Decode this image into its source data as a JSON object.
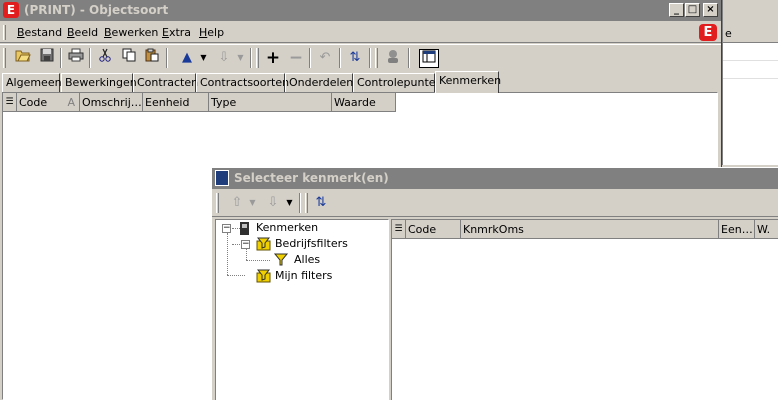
{
  "background_window": {
    "header_fragment": "e"
  },
  "main_window": {
    "title": "(PRINT) - Objectsoort",
    "app_icon_letter": "E",
    "caption_buttons": {
      "minimize": "_",
      "maximize": "□",
      "close": "×"
    }
  },
  "menu": {
    "items": [
      "Bestand",
      "Beeld",
      "Bewerken",
      "Extra",
      "Help"
    ],
    "brand_letter": "E"
  },
  "toolbar": {
    "icons": [
      "open-folder-icon",
      "save-icon",
      "print-icon",
      "cut-icon",
      "copy-icon",
      "paste-icon",
      "arrow-up-icon",
      "arrow-down-icon",
      "add-icon",
      "remove-icon",
      "undo-icon",
      "refresh-icon",
      "person-icon",
      "window-icon"
    ]
  },
  "tabs": {
    "items": [
      "Algemeen",
      "Bewerkingen",
      "Contracten",
      "Contractsoorten",
      "Onderdelen",
      "Controlepunten",
      "Kenmerken"
    ],
    "active": "Kenmerken"
  },
  "grid": {
    "columns": [
      "Code",
      "Omschrij…",
      "Eenheid",
      "Type",
      "Waarde"
    ],
    "sort_indicator": "A"
  },
  "dialog": {
    "title": "Selecteer kenmerk(en)",
    "tree": {
      "root": "Kenmerken",
      "children": [
        {
          "label": "Bedrijfsfilters",
          "children": [
            {
              "label": "Alles"
            }
          ]
        },
        {
          "label": "Mijn filters"
        }
      ]
    },
    "list_columns": [
      "Code",
      "KnmrkOms",
      "Een…",
      "W."
    ]
  },
  "colors": {
    "window_face": "#d4d0c8",
    "inactive_title": "#808080",
    "brand_red": "#e21d1d",
    "filter_yellow": "#f0d000"
  }
}
